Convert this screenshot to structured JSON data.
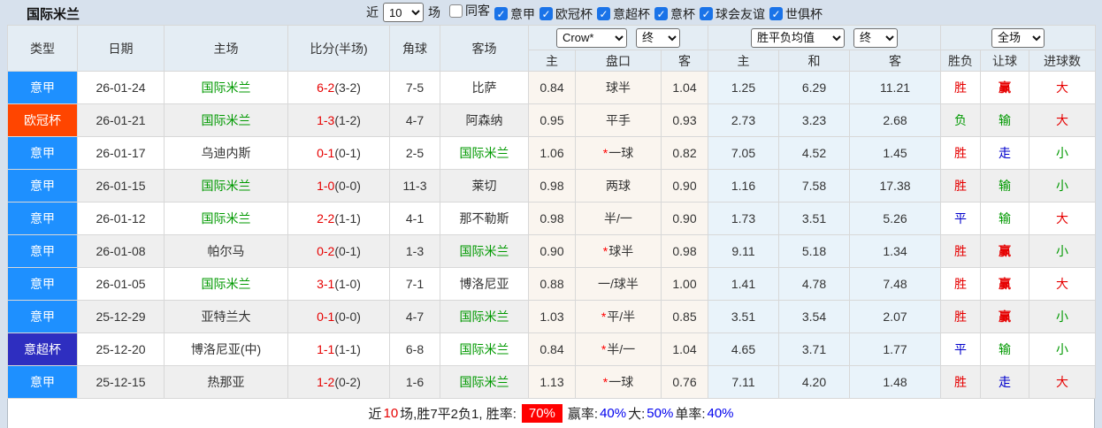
{
  "title": "国际米兰",
  "filters": {
    "recent_prefix": "近",
    "recent_value": "10",
    "recent_suffix": "场",
    "checkboxes": [
      {
        "label": "同客",
        "checked": false
      },
      {
        "label": "意甲",
        "checked": true
      },
      {
        "label": "欧冠杯",
        "checked": true
      },
      {
        "label": "意超杯",
        "checked": true
      },
      {
        "label": "意杯",
        "checked": true
      },
      {
        "label": "球会友谊",
        "checked": true
      },
      {
        "label": "世俱杯",
        "checked": true
      }
    ]
  },
  "header": {
    "columns": {
      "type": "类型",
      "date": "日期",
      "home": "主场",
      "score": "比分(半场)",
      "corner": "角球",
      "away": "客场"
    },
    "odds_group": {
      "bookmaker_select": "Crow*",
      "time_select": "终",
      "sub": {
        "home": "主",
        "handicap": "盘口",
        "away": "客"
      }
    },
    "avg_group": {
      "select": "胜平负均值",
      "time_select": "终",
      "sub": {
        "home": "主",
        "draw": "和",
        "away": "客"
      }
    },
    "result_group": {
      "select": "全场",
      "sub": {
        "result": "胜负",
        "handicap": "让球",
        "goals": "进球数"
      }
    }
  },
  "colors": {
    "serie_a_badge": "#1E90FF",
    "champions_badge": "#FF4500",
    "super_cup_badge": "#2E2EC0",
    "team_highlight": "#009900",
    "win": "#E60000",
    "lose": "#009900",
    "draw": "#0000CC",
    "hot_value": "#FF6600",
    "rate_badge_bg": "#FF0000"
  },
  "table": {
    "rows": [
      {
        "type": "意甲",
        "type_class": "lg-blue",
        "date": "26-01-24",
        "home": "国际米兰",
        "home_green": true,
        "score": "6-2",
        "half": "(3-2)",
        "corner": "7-5",
        "away": "比萨",
        "away_green": false,
        "odds": [
          "0.84",
          "1.04"
        ],
        "handicap": "球半",
        "star": false,
        "avg": [
          "1.25",
          "6.29",
          "11.21"
        ],
        "avg_mid_hot": false,
        "result": {
          "t": "胜",
          "c": "red"
        },
        "let": {
          "t": "赢",
          "c": "red bold"
        },
        "goal": {
          "t": "大",
          "c": "red"
        }
      },
      {
        "type": "欧冠杯",
        "type_class": "lg-orange",
        "date": "26-01-21",
        "home": "国际米兰",
        "home_green": true,
        "score": "1-3",
        "half": "(1-2)",
        "corner": "4-7",
        "away": "阿森纳",
        "away_green": false,
        "odds": [
          "0.95",
          "0.93"
        ],
        "handicap": "平手",
        "star": false,
        "avg": [
          "2.73",
          "3.23",
          "2.68"
        ],
        "avg_mid_hot": false,
        "result": {
          "t": "负",
          "c": "green"
        },
        "let": {
          "t": "输",
          "c": "green"
        },
        "goal": {
          "t": "大",
          "c": "red"
        }
      },
      {
        "type": "意甲",
        "type_class": "lg-blue",
        "date": "26-01-17",
        "home": "乌迪内斯",
        "home_green": false,
        "score": "0-1",
        "half": "(0-1)",
        "corner": "2-5",
        "away": "国际米兰",
        "away_green": true,
        "odds": [
          "1.06",
          "0.82"
        ],
        "handicap": "一球",
        "star": true,
        "avg": [
          "7.05",
          "4.52",
          "1.45"
        ],
        "avg_mid_hot": false,
        "result": {
          "t": "胜",
          "c": "red"
        },
        "let": {
          "t": "走",
          "c": "blue"
        },
        "goal": {
          "t": "小",
          "c": "green"
        }
      },
      {
        "type": "意甲",
        "type_class": "lg-blue",
        "date": "26-01-15",
        "home": "国际米兰",
        "home_green": true,
        "score": "1-0",
        "half": "(0-0)",
        "corner": "11-3",
        "away": "莱切",
        "away_green": false,
        "odds": [
          "0.98",
          "0.90"
        ],
        "handicap": "两球",
        "star": false,
        "avg": [
          "1.16",
          "7.58",
          "17.38"
        ],
        "avg_mid_hot": false,
        "result": {
          "t": "胜",
          "c": "red"
        },
        "let": {
          "t": "输",
          "c": "green"
        },
        "goal": {
          "t": "小",
          "c": "green"
        }
      },
      {
        "type": "意甲",
        "type_class": "lg-blue",
        "date": "26-01-12",
        "home": "国际米兰",
        "home_green": true,
        "score": "2-2",
        "half": "(1-1)",
        "corner": "4-1",
        "away": "那不勒斯",
        "away_green": false,
        "odds": [
          "0.98",
          "0.90"
        ],
        "handicap": "半/一",
        "star": false,
        "avg": [
          "1.73",
          "3.51",
          "5.26"
        ],
        "avg_mid_hot": false,
        "result": {
          "t": "平",
          "c": "blue"
        },
        "let": {
          "t": "输",
          "c": "green"
        },
        "goal": {
          "t": "大",
          "c": "red"
        }
      },
      {
        "type": "意甲",
        "type_class": "lg-blue",
        "date": "26-01-08",
        "home": "帕尔马",
        "home_green": false,
        "score": "0-2",
        "half": "(0-1)",
        "corner": "1-3",
        "away": "国际米兰",
        "away_green": true,
        "odds": [
          "0.90",
          "0.98"
        ],
        "handicap": "球半",
        "star": true,
        "avg": [
          "9.11",
          "5.18",
          "1.34"
        ],
        "avg_mid_hot": false,
        "result": {
          "t": "胜",
          "c": "red"
        },
        "let": {
          "t": "赢",
          "c": "red bold"
        },
        "goal": {
          "t": "小",
          "c": "green"
        }
      },
      {
        "type": "意甲",
        "type_class": "lg-blue",
        "date": "26-01-05",
        "home": "国际米兰",
        "home_green": true,
        "score": "3-1",
        "half": "(1-0)",
        "corner": "7-1",
        "away": "博洛尼亚",
        "away_green": false,
        "odds": [
          "0.88",
          "1.00"
        ],
        "handicap": "一/球半",
        "star": false,
        "avg": [
          "1.41",
          "4.78",
          "7.48"
        ],
        "avg_mid_hot": false,
        "result": {
          "t": "胜",
          "c": "red"
        },
        "let": {
          "t": "赢",
          "c": "red bold"
        },
        "goal": {
          "t": "大",
          "c": "red"
        }
      },
      {
        "type": "意甲",
        "type_class": "lg-blue",
        "date": "25-12-29",
        "home": "亚特兰大",
        "home_green": false,
        "score": "0-1",
        "half": "(0-0)",
        "corner": "4-7",
        "away": "国际米兰",
        "away_green": true,
        "odds": [
          "1.03",
          "0.85"
        ],
        "handicap": "平/半",
        "star": true,
        "avg": [
          "3.51",
          "3.54",
          "2.07"
        ],
        "avg_mid_hot": false,
        "result": {
          "t": "胜",
          "c": "red"
        },
        "let": {
          "t": "赢",
          "c": "red bold"
        },
        "goal": {
          "t": "小",
          "c": "green"
        }
      },
      {
        "type": "意超杯",
        "type_class": "lg-purple",
        "date": "25-12-20",
        "home": "博洛尼亚(中)",
        "home_green": false,
        "score": "1-1",
        "half": "(1-1)",
        "corner": "6-8",
        "away": "国际米兰",
        "away_green": true,
        "odds": [
          "0.84",
          "1.04"
        ],
        "handicap": "半/一",
        "star": true,
        "avg": [
          "4.65",
          "3.71",
          "1.77"
        ],
        "avg_mid_hot": true,
        "result": {
          "t": "平",
          "c": "blue"
        },
        "let": {
          "t": "输",
          "c": "green"
        },
        "goal": {
          "t": "小",
          "c": "green"
        }
      },
      {
        "type": "意甲",
        "type_class": "lg-blue",
        "date": "25-12-15",
        "home": "热那亚",
        "home_green": false,
        "score": "1-2",
        "half": "(0-2)",
        "corner": "1-6",
        "away": "国际米兰",
        "away_green": true,
        "odds": [
          "1.13",
          "0.76"
        ],
        "handicap": "一球",
        "star": true,
        "avg": [
          "7.11",
          "4.20",
          "1.48"
        ],
        "avg_mid_hot": false,
        "result": {
          "t": "胜",
          "c": "red"
        },
        "let": {
          "t": "走",
          "c": "blue"
        },
        "goal": {
          "t": "大",
          "c": "red"
        }
      }
    ]
  },
  "footer": {
    "seg1": "近",
    "count": "10",
    "seg2": "场,胜7平2负1, 胜率:",
    "win_rate": "70%",
    "seg3": "赢率:",
    "win_odds_rate": "40%",
    "seg4": "大:",
    "big_rate": "50%",
    "seg5": "单率:",
    "single_rate": "40%"
  }
}
